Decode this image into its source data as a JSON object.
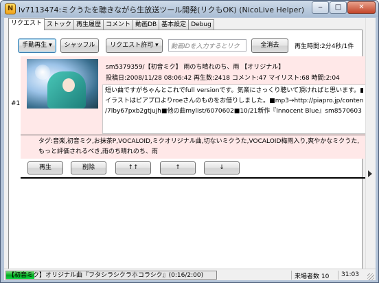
{
  "window": {
    "title": "lv7113474:ミクうたを聴きながら生放送ツール開発(リクもOK) (NicoLive Helper)",
    "minimize_glyph": "‒",
    "maximize_glyph": "□",
    "close_glyph": "✕"
  },
  "tabs": [
    {
      "label": "リクエスト",
      "active": true
    },
    {
      "label": "ストック",
      "active": false
    },
    {
      "label": "再生履歴",
      "active": false
    },
    {
      "label": "コメント",
      "active": false
    },
    {
      "label": "動画DB",
      "active": false
    },
    {
      "label": "基本設定",
      "active": false
    },
    {
      "label": "Debug",
      "active": false
    }
  ],
  "toolbar": {
    "play_mode_label": "手動再生",
    "shuffle_label": "シャッフル",
    "request_permit_label": "リクエスト許可",
    "video_id_placeholder": "動画IDを入力するとリク",
    "clear_all_label": "全消去",
    "play_time": "再生時間:2分4秒/1件"
  },
  "request": {
    "index": "#1",
    "thumbnail_alt": "Hatsune Miku illustration",
    "title_line": "sm5379359/【初音ミク】 雨のち晴れのち、雨 【オリジナル】",
    "meta_line": "投稿日:2008/11/28 08:06:42 再生数:2418 コメント:47 マイリスト:68 時間:2:04",
    "description": [
      "短い曲ですがちゃんとこれでfull versionです。気楽にさっくり聴いて頂ければと思います。■",
      "イラストはピアプロよりroeさんのものをお借りしました。■mp3→http://piapro.jp/content",
      "/7lby67pxb2gtjujh■他の曲mylist/6070602■10/21新作『Innocent Blue』sm8570603"
    ],
    "tags": [
      "タグ:音楽,初音ミク,お抹茶P,VOCALOID,ミクオリジナル曲,切ないミクうた,VOCALOID梅雨入り,爽やかなミクうた,",
      "もっと評価されるべき,雨のち晴れのち、雨"
    ],
    "actions": {
      "play": "再生",
      "delete": "削除",
      "move_top": "↑↑",
      "move_up": "↑",
      "move_down": "↓"
    }
  },
  "status": {
    "now_playing": "【初音ミク】オリジナル曲『フタシラシクラホコラシク』(0:16/2:00)",
    "progress": 0.133,
    "visitors": "来場者数 10",
    "clock": "31:03"
  },
  "colors": {
    "item_background": "#ffe8e8",
    "progress_fill": "#06b025"
  }
}
